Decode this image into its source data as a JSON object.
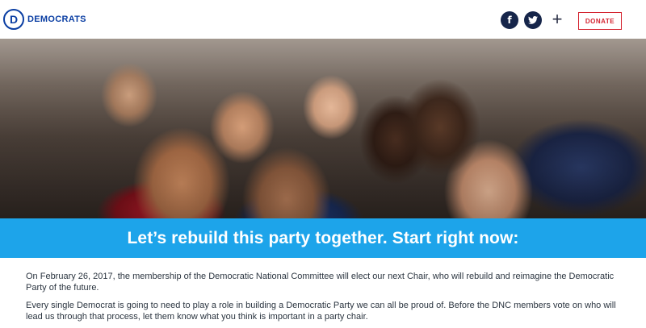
{
  "header": {
    "logo_letter": "D",
    "logo_text": "DEMOCRATS",
    "facebook_glyph": "f",
    "twitter_icon": "twitter-bird-icon",
    "more_glyph": "+",
    "donate_label": "DONATE"
  },
  "hero": {
    "image_alt": "",
    "icon": "crowd-photo"
  },
  "banner": {
    "headline": "Let’s rebuild this party together. Start right now:"
  },
  "body": {
    "paragraph_1": "On February 26, 2017, the membership of the Democratic National Committee will elect our next Chair, who will rebuild and reimagine the Democratic Party of the future.",
    "paragraph_2": "Every single Democrat is going to need to play a role in building a Democratic Party we can all be proud of. Before the DNC members vote on who will lead us through that process, let them know what you think is important in a party chair."
  },
  "colors": {
    "brand_blue": "#0a3ea3",
    "banner_blue": "#1da4ea",
    "donate_red": "#d4232f",
    "social_navy": "#16254a"
  }
}
